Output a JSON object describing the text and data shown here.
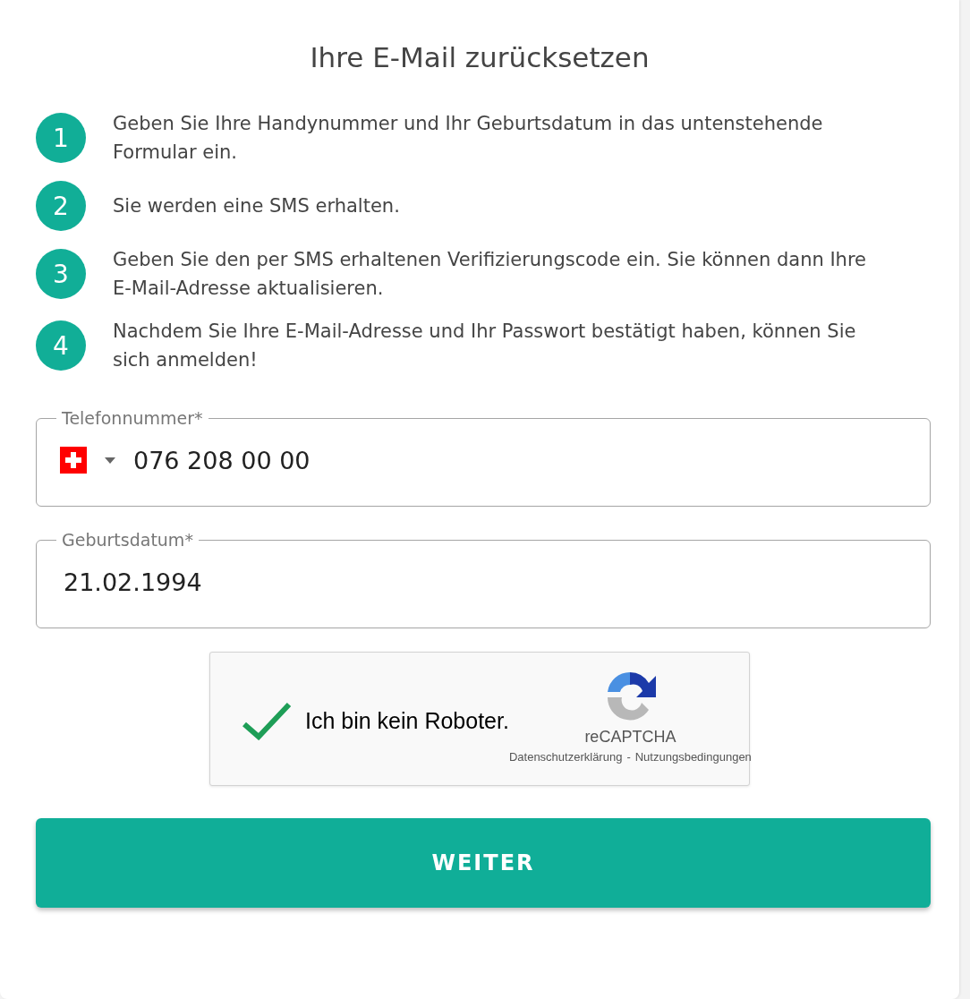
{
  "title": "Ihre E-Mail zurücksetzen",
  "steps": [
    {
      "number": "1",
      "text": "Geben Sie Ihre Handynummer und Ihr Geburtsdatum in das untenstehende Formular ein."
    },
    {
      "number": "2",
      "text": "Sie werden eine SMS erhalten."
    },
    {
      "number": "3",
      "text": "Geben Sie den per SMS erhaltenen Verifizierungscode ein. Sie können dann Ihre E-Mail-Adresse aktualisieren."
    },
    {
      "number": "4",
      "text": "Nachdem Sie Ihre E-Mail-Adresse und Ihr Passwort bestätigt haben, können Sie sich anmelden!"
    }
  ],
  "phone_field": {
    "label": "Telefonnummer*",
    "value": "076 208 00 00"
  },
  "birthdate_field": {
    "label": "Geburtsdatum*",
    "value": "21.02.1994"
  },
  "captcha": {
    "checked": true,
    "label": "Ich bin kein Roboter.",
    "brand": "reCAPTCHA",
    "privacy_link": "Datenschutzerklärung",
    "separator": "-",
    "terms_link": "Nutzungsbedingungen"
  },
  "submit_button": "WEITER"
}
